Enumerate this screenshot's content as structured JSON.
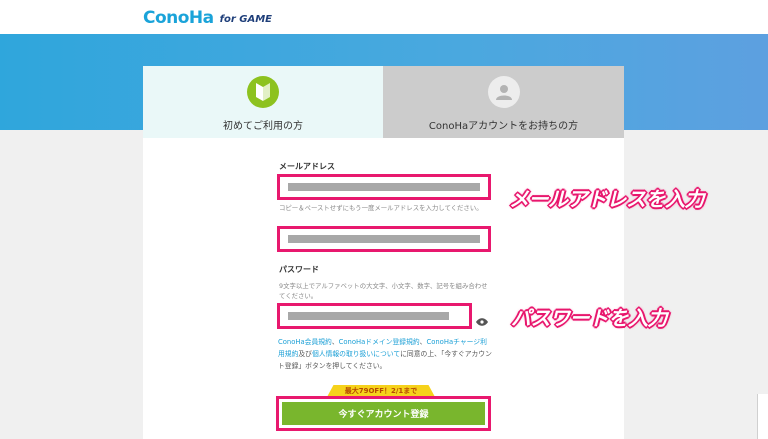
{
  "header": {
    "logo_main": "ConoHa",
    "logo_sub": "for GAME"
  },
  "tabs": [
    {
      "label": "初めてご利用の方",
      "icon": "beginner-mark-icon"
    },
    {
      "label": "ConoHaアカウントをお持ちの方",
      "icon": "user-icon"
    }
  ],
  "form": {
    "email_label": "メールアドレス",
    "email_confirm_hint": "コピー＆ペーストせずにもう一度メールアドレスを入力してください。",
    "password_label": "パスワード",
    "password_hint": "9文字以上でアルファベットの大文字、小文字、数字、記号を組み合わせてください。",
    "terms": {
      "link1": "ConoHa会員規約",
      "sep1": "、",
      "link2": "ConoHaドメイン登録規約",
      "sep2": "、",
      "link3": "ConoHaチャージ利用規約",
      "sep3": "及び",
      "link4": "個人情報の取り扱いについて",
      "tail": "に同意の上、「今すぐアカウント登録」ボタンを押してください。"
    },
    "badge": "最大79OFF！2/1まで",
    "submit_label": "今すぐアカウント登録"
  },
  "annotations": {
    "email": "メールアドレスを入力",
    "password": "パスワードを入力"
  },
  "colors": {
    "brand_blue": "#1aa3d9",
    "highlight_pink": "#e8186e",
    "cta_green": "#79b62d",
    "beginner_green": "#8dc21f"
  }
}
